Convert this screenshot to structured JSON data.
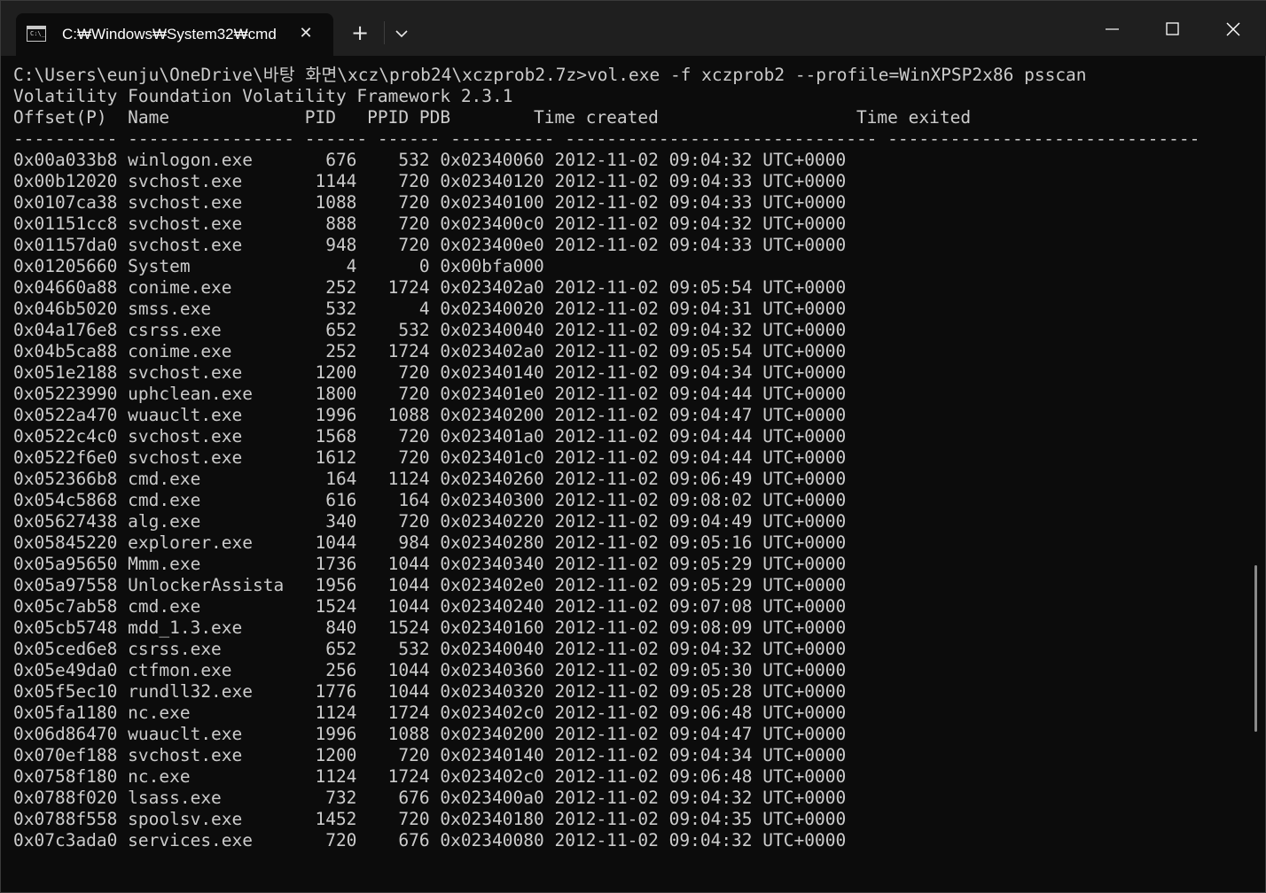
{
  "window": {
    "tab_title": "C:₩Windows₩System32₩cmd",
    "tab_icon_prompt": "C:\\_",
    "close_tab_symbol": "✕",
    "new_tab_symbol": "+",
    "colors": {
      "background": "#0c0c0c",
      "titlebar": "#1f1f1f",
      "text": "#cccccc"
    }
  },
  "terminal": {
    "command_line": "C:\\Users\\eunju\\OneDrive\\바탕 화면\\xcz\\prob24\\xczprob2.7z>vol.exe -f xczprob2 --profile=WinXPSP2x86 psscan",
    "banner": "Volatility Foundation Volatility Framework 2.3.1",
    "header": "Offset(P)  Name             PID   PPID PDB        Time created                   Time exited",
    "separator": "---------- ---------------- ------ ------ ---------- ------------------------------ ------------------------------",
    "rows": [
      "0x00a033b8 winlogon.exe       676    532 0x02340060 2012-11-02 09:04:32 UTC+0000",
      "0x00b12020 svchost.exe       1144    720 0x02340120 2012-11-02 09:04:33 UTC+0000",
      "0x0107ca38 svchost.exe       1088    720 0x02340100 2012-11-02 09:04:33 UTC+0000",
      "0x01151cc8 svchost.exe        888    720 0x023400c0 2012-11-02 09:04:32 UTC+0000",
      "0x01157da0 svchost.exe        948    720 0x023400e0 2012-11-02 09:04:33 UTC+0000",
      "0x01205660 System               4      0 0x00bfa000",
      "0x04660a88 conime.exe         252   1724 0x023402a0 2012-11-02 09:05:54 UTC+0000",
      "0x046b5020 smss.exe           532      4 0x02340020 2012-11-02 09:04:31 UTC+0000",
      "0x04a176e8 csrss.exe          652    532 0x02340040 2012-11-02 09:04:32 UTC+0000",
      "0x04b5ca88 conime.exe         252   1724 0x023402a0 2012-11-02 09:05:54 UTC+0000",
      "0x051e2188 svchost.exe       1200    720 0x02340140 2012-11-02 09:04:34 UTC+0000",
      "0x05223990 uphclean.exe      1800    720 0x023401e0 2012-11-02 09:04:44 UTC+0000",
      "0x0522a470 wuauclt.exe       1996   1088 0x02340200 2012-11-02 09:04:47 UTC+0000",
      "0x0522c4c0 svchost.exe       1568    720 0x023401a0 2012-11-02 09:04:44 UTC+0000",
      "0x0522f6e0 svchost.exe       1612    720 0x023401c0 2012-11-02 09:04:44 UTC+0000",
      "0x052366b8 cmd.exe            164   1124 0x02340260 2012-11-02 09:06:49 UTC+0000",
      "0x054c5868 cmd.exe            616    164 0x02340300 2012-11-02 09:08:02 UTC+0000",
      "0x05627438 alg.exe            340    720 0x02340220 2012-11-02 09:04:49 UTC+0000",
      "0x05845220 explorer.exe      1044    984 0x02340280 2012-11-02 09:05:16 UTC+0000",
      "0x05a95650 Mmm.exe           1736   1044 0x02340340 2012-11-02 09:05:29 UTC+0000",
      "0x05a97558 UnlockerAssista   1956   1044 0x023402e0 2012-11-02 09:05:29 UTC+0000",
      "0x05c7ab58 cmd.exe           1524   1044 0x02340240 2012-11-02 09:07:08 UTC+0000",
      "0x05cb5748 mdd_1.3.exe        840   1524 0x02340160 2012-11-02 09:08:09 UTC+0000",
      "0x05ced6e8 csrss.exe          652    532 0x02340040 2012-11-02 09:04:32 UTC+0000",
      "0x05e49da0 ctfmon.exe         256   1044 0x02340360 2012-11-02 09:05:30 UTC+0000",
      "0x05f5ec10 rundll32.exe      1776   1044 0x02340320 2012-11-02 09:05:28 UTC+0000",
      "0x05fa1180 nc.exe            1124   1724 0x023402c0 2012-11-02 09:06:48 UTC+0000",
      "0x06d86470 wuauclt.exe       1996   1088 0x02340200 2012-11-02 09:04:47 UTC+0000",
      "0x070ef188 svchost.exe       1200    720 0x02340140 2012-11-02 09:04:34 UTC+0000",
      "0x0758f180 nc.exe            1124   1724 0x023402c0 2012-11-02 09:06:48 UTC+0000",
      "0x0788f020 lsass.exe          732    676 0x023400a0 2012-11-02 09:04:32 UTC+0000",
      "0x0788f558 spoolsv.exe       1452    720 0x02340180 2012-11-02 09:04:35 UTC+0000",
      "0x07c3ada0 services.exe       720    676 0x02340080 2012-11-02 09:04:32 UTC+0000"
    ]
  }
}
